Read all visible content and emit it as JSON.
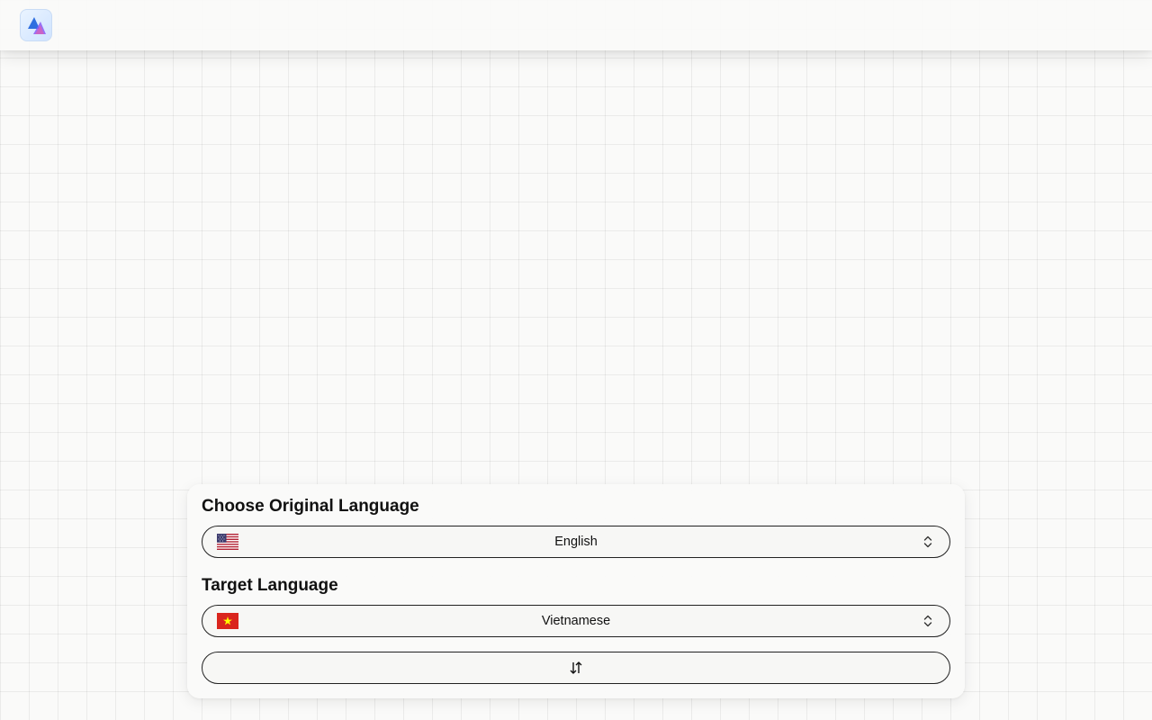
{
  "app": {
    "logo_icon": "app-logo-triangles-icon"
  },
  "original": {
    "title": "Choose Original Language",
    "selected": "English",
    "flag_icon": "us-flag-icon"
  },
  "target": {
    "title": "Target Language",
    "selected": "Vietnamese",
    "flag_icon": "vn-flag-icon"
  },
  "swap": {
    "icon": "swap-vertical-arrows-icon"
  },
  "colors": {
    "border": "#222222",
    "background": "#fafaf9",
    "logo_blue": "#2f6fe0",
    "logo_purple": "#8a5cf6"
  }
}
